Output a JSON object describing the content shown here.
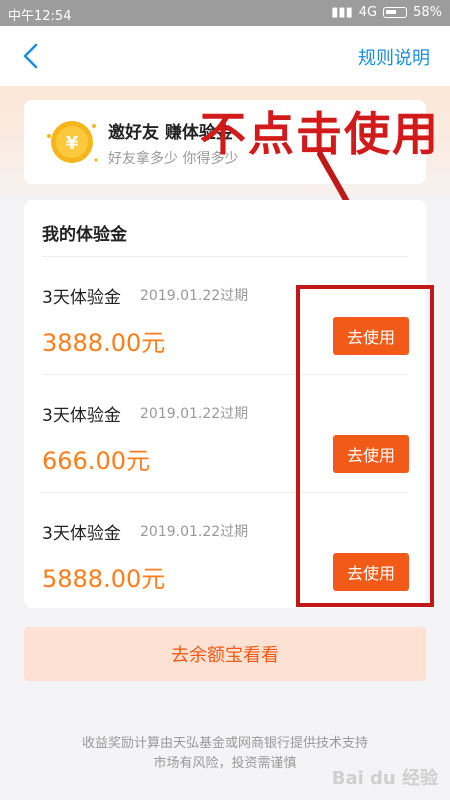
{
  "status_bar": {
    "time": "中午12:54",
    "network": "4G",
    "battery": "58%"
  },
  "nav": {
    "back_icon": "chevron-left-icon",
    "rules_link": "规则说明"
  },
  "invite_card": {
    "icon": "yuan-coin-icon",
    "title": "邀好友 赚体验金",
    "subtitle": "好友拿多少 你得多少"
  },
  "annotation": {
    "text": "不点击使用",
    "color": "#d11a1a"
  },
  "vouchers_panel": {
    "title": "我的体验金",
    "items": [
      {
        "name": "3天体验金",
        "expiry": "2019.01.22过期",
        "amount": "3888.00元",
        "button": "去使用"
      },
      {
        "name": "3天体验金",
        "expiry": "2019.01.22过期",
        "amount": "666.00元",
        "button": "去使用"
      },
      {
        "name": "3天体验金",
        "expiry": "2019.01.22过期",
        "amount": "5888.00元",
        "button": "去使用"
      }
    ]
  },
  "yuebao_button": "去余额宝看看",
  "footer": {
    "line1": "收益奖励计算由天弘基金或网商银行提供技术支持",
    "line2": "市场有风险，投资需谨慎"
  },
  "watermark": "Bai du 经验",
  "colors": {
    "accent_orange": "#f25a17",
    "amount_orange": "#ff7d1a",
    "link_blue": "#1a8ee5",
    "annotation_red": "#d11a1a"
  }
}
